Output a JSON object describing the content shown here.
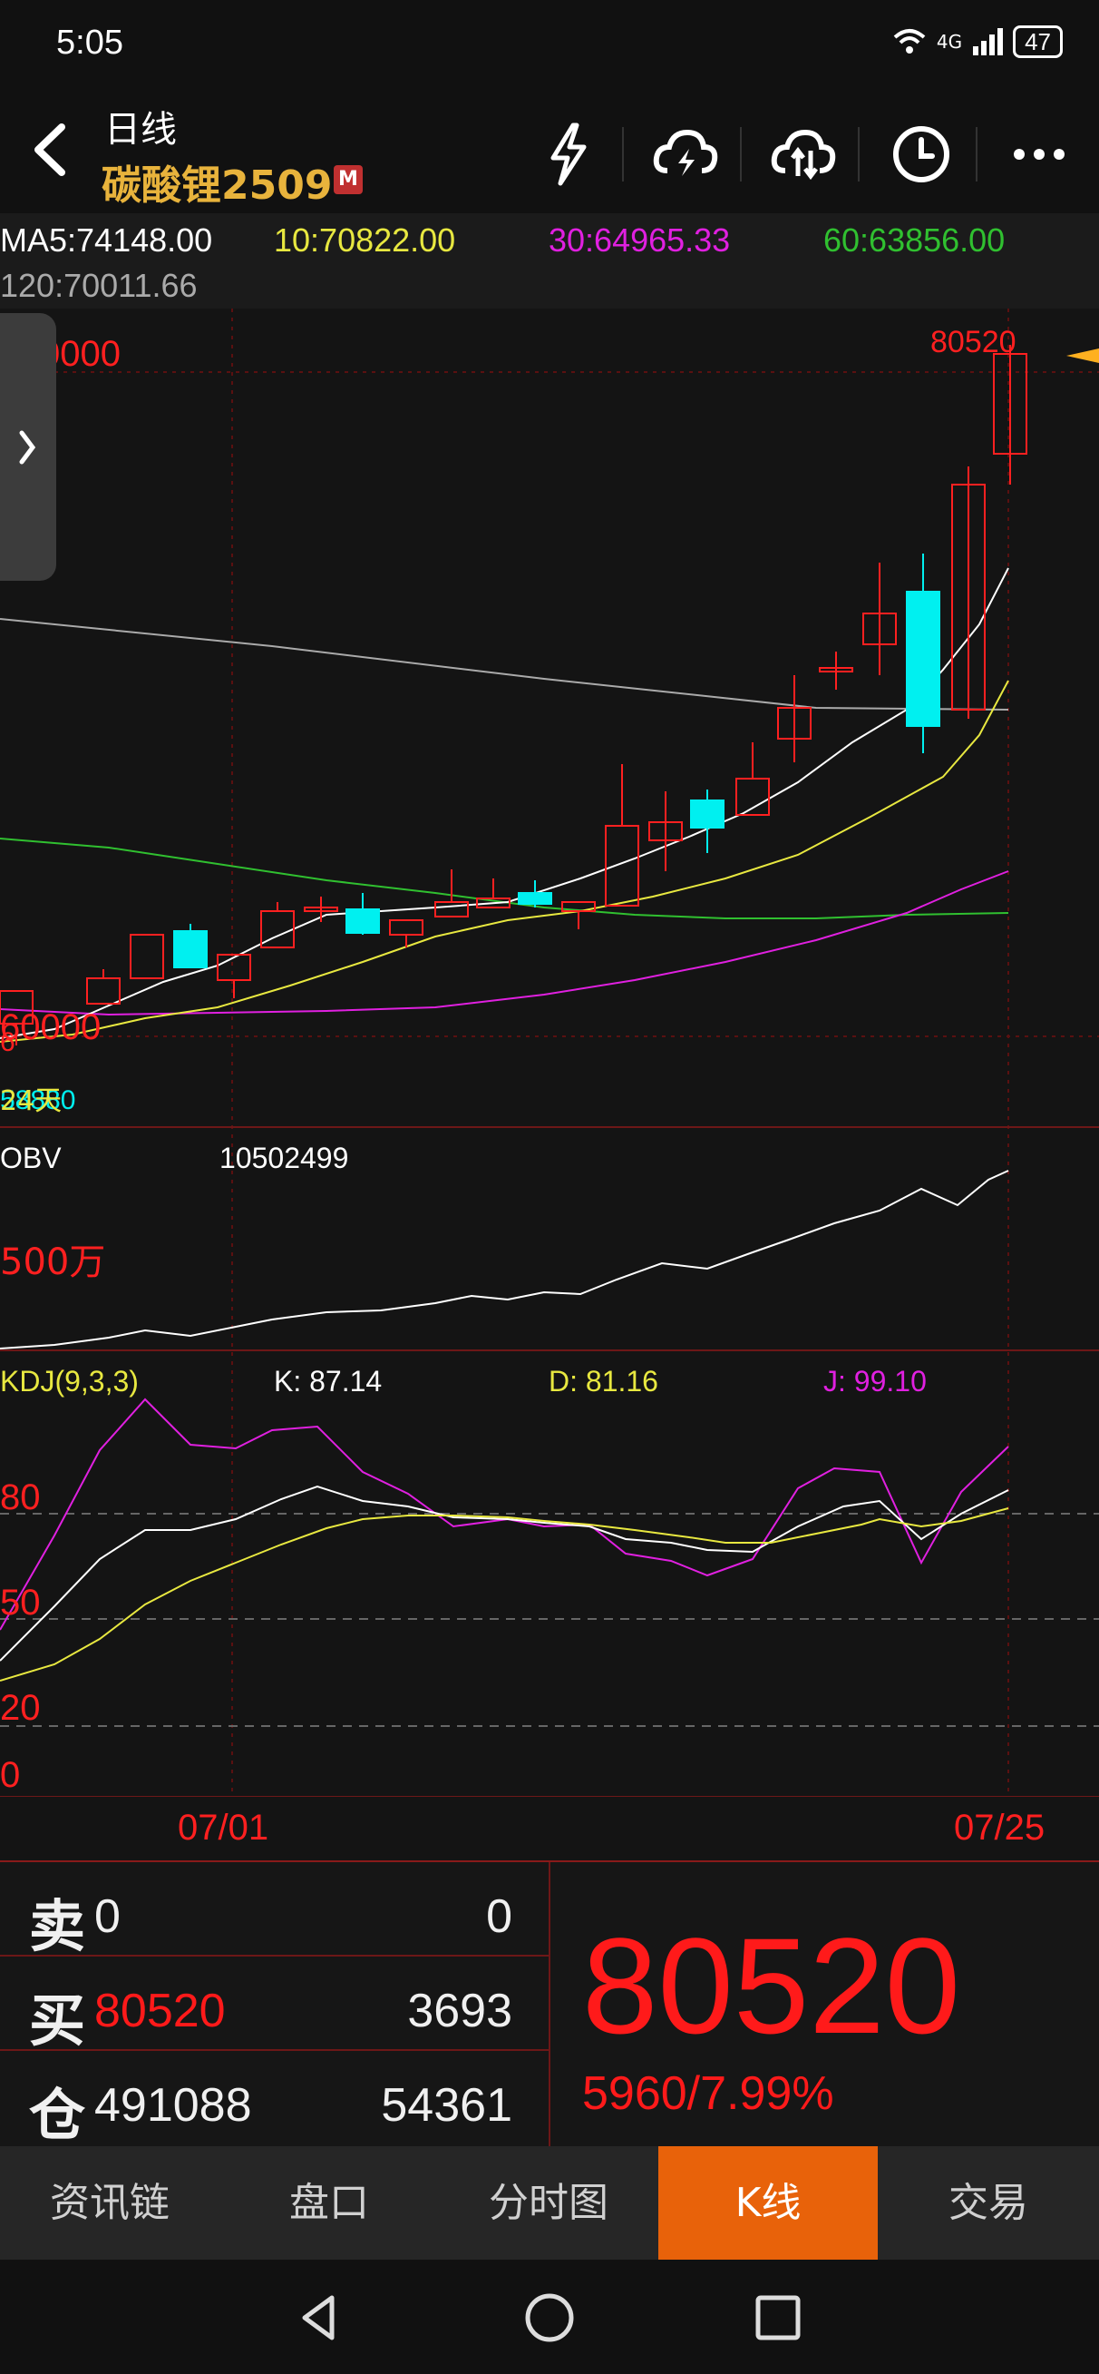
{
  "status": {
    "time": "5:05",
    "network": "4G",
    "wifi_label": "6",
    "battery": "47"
  },
  "header": {
    "title": "日线",
    "symbol": "碳酸锂2509",
    "badge": "M"
  },
  "ma": {
    "ma5": "MA5:74148.00",
    "ma10": "10:70822.00",
    "ma30": "30:64965.33",
    "ma60": "60:63856.00",
    "ma120": "120:70011.66"
  },
  "price_chart": {
    "top_label": "80520",
    "hi_axis": "0000",
    "lo_axis": "60000",
    "lo_axis_prefix": "6",
    "days_label": "24天",
    "small_label": "58880"
  },
  "obv": {
    "label": "OBV",
    "value": "10502499",
    "axis": "500万"
  },
  "kdj": {
    "label": "KDJ(9,3,3)",
    "k": "K: 87.14",
    "d": "D: 81.16",
    "j": "J: 99.10",
    "axis": [
      "80",
      "50",
      "20",
      "0"
    ]
  },
  "dates": {
    "left": "07/01",
    "right": "07/25"
  },
  "quote": {
    "sell_label": "卖",
    "sell_price": "0",
    "sell_vol": "0",
    "buy_label": "买",
    "buy_price": "80520",
    "buy_vol": "3693",
    "oi_label": "仓",
    "oi_value": "491088",
    "oi_change": "54361",
    "last_price": "80520",
    "change": "5960/7.99%"
  },
  "tabs": [
    "资讯链",
    "盘口",
    "分时图",
    "K线",
    "交易"
  ],
  "colors": {
    "up": "#ff1a1a",
    "down": "#00f0f0",
    "ma5": "#ffffff",
    "ma10": "#e8e840",
    "ma30": "#e020e0",
    "ma60": "#30c030",
    "ma120": "#aaaaaa",
    "accent": "#e8620a"
  },
  "chart_data": {
    "type": "candlestick",
    "dates": [
      "07/01",
      "07/25"
    ],
    "last_close": 80520,
    "ma": {
      "MA5": 74148.0,
      "MA10": 70822.0,
      "MA30": 64965.33,
      "MA60": 63856.0,
      "MA120": 70011.66
    },
    "obv": 10502499,
    "kdj": {
      "K": 87.14,
      "D": 81.16,
      "J": 99.1
    }
  }
}
